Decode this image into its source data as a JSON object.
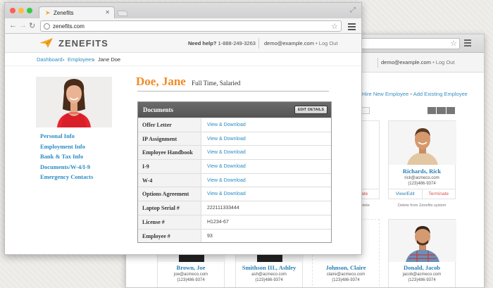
{
  "front": {
    "tab_title": "Zenefits",
    "url": "zenefits.com",
    "brand": "ZENEFITS",
    "help_label": "Need help?",
    "help_phone": "1-888-249-3263",
    "user_email": "demo@example.com",
    "logout": "Log Out",
    "breadcrumb": [
      {
        "label": "Dashboard"
      },
      {
        "label": "Employees"
      },
      {
        "label": "Jane Doe"
      }
    ],
    "employee": {
      "name": "Doe, Jane",
      "status": "Full Time, Salaried"
    },
    "side_menu": [
      "Personal Info",
      "Employment Info",
      "Bank & Tax Info",
      "Documents/W-4/I-9",
      "Emergency Contacts"
    ],
    "documents": {
      "title": "Documents",
      "edit_button": "EDIT DETAILS",
      "rows": [
        {
          "label": "Offer Letter",
          "value": "View & Download"
        },
        {
          "label": "IP Assignment",
          "value": "View & Download"
        },
        {
          "label": "Employee Handbook",
          "value": "View & Download"
        },
        {
          "label": "I-9",
          "value": "View & Download"
        },
        {
          "label": "W-4",
          "value": "View & Download"
        },
        {
          "label": "Options Agreement",
          "value": "View & Download"
        },
        {
          "label": "Laptop Serial #",
          "value": "222111333444"
        },
        {
          "label": "License #",
          "value": "H1234-67"
        },
        {
          "label": "Employee #",
          "value": "93"
        }
      ]
    }
  },
  "back": {
    "user_email": "demo@example.com",
    "logout": "Log Out",
    "hire_link": "Hire New Employee",
    "link_sep": "•",
    "add_link": "Add Existing Employee",
    "cards": [
      {
        "name": "Richards, Rick",
        "email": "rick@acmeco.com",
        "phone": "(123)486-9374",
        "view": "View/Edit",
        "terminate": "Terminate"
      },
      {
        "name": "Brown, Joe",
        "email": "joe@acmeco.com",
        "phone": "(123)486-9374"
      },
      {
        "name": "Smithson III., Ashley",
        "email": "ash@acmeco.com",
        "phone": "(123)486-9374"
      },
      {
        "name": "Johnson, Claire",
        "email": "claire@acmeco.com",
        "phone": "(123)486-9374"
      },
      {
        "name": "Donald, Jacob",
        "email": "jacob@acmeco.com",
        "phone": "(123)486-9374"
      }
    ],
    "partial_terminate": "Terminate",
    "delete_note_1": "Delete",
    "delete_note_2": "Delete from Zenefits system"
  },
  "colors": {
    "accent_orange": "#f08a24",
    "link_blue": "#2a8cc4",
    "terminate_red": "#d9534f"
  }
}
